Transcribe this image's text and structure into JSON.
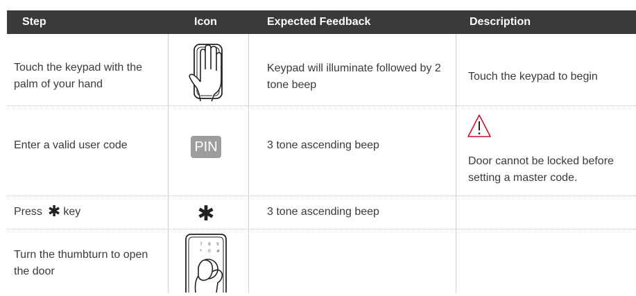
{
  "header": {
    "step": "Step",
    "icon": "Icon",
    "feedback": "Expected Feedback",
    "description": "Description"
  },
  "rows": [
    {
      "step": "Touch the keypad with the palm of your hand",
      "icon": "palm-on-keypad-icon",
      "feedback": "Keypad will illuminate followed by 2 tone beep",
      "description": "Touch the keypad to begin"
    },
    {
      "step": "Enter a valid user code",
      "icon": "pin-icon",
      "icon_text": "PIN",
      "feedback": "3 tone ascending beep",
      "description": "Door cannot be locked before setting a master code.",
      "description_icon": "warning-icon"
    },
    {
      "step_prefix": "Press",
      "step_symbol": "✱",
      "step_suffix": "key",
      "icon": "star-key-icon",
      "icon_text": "✱",
      "feedback": "3 tone ascending beep",
      "description": ""
    },
    {
      "step": "Turn the thumbturn to open the door",
      "icon": "hand-turning-thumbturn-icon",
      "feedback": "",
      "description": ""
    }
  ],
  "colors": {
    "header_bg": "#3a3a3a",
    "header_text": "#ffffff",
    "body_text": "#3a3a3a",
    "pin_icon_bg": "#9d9d9d",
    "warning_stroke": "#c8102e"
  }
}
